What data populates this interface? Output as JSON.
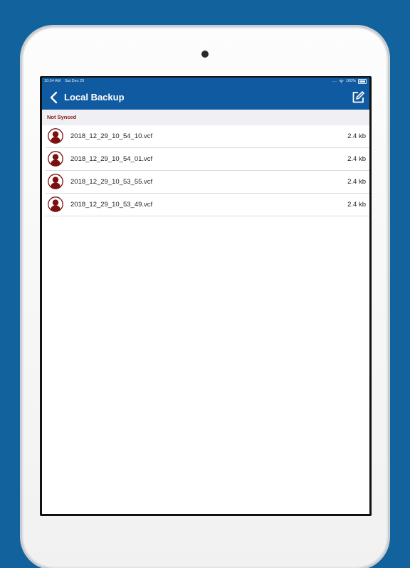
{
  "status_bar": {
    "time": "10:54 AM",
    "date": "Sat Dec 29",
    "signal": "....",
    "battery": "100%"
  },
  "nav": {
    "title": "Local Backup",
    "back_icon": "chevron-left-icon",
    "edit_icon": "compose-icon"
  },
  "section": {
    "title": "Not Synced"
  },
  "files": [
    {
      "name": "2018_12_29_10_54_10.vcf",
      "size": "2.4 kb"
    },
    {
      "name": "2018_12_29_10_54_01.vcf",
      "size": "2.4 kb"
    },
    {
      "name": "2018_12_29_10_53_55.vcf",
      "size": "2.4 kb"
    },
    {
      "name": "2018_12_29_10_53_49.vcf",
      "size": "2.4 kb"
    }
  ],
  "colors": {
    "background": "#12639d",
    "navbar": "#0f5aa0",
    "section_text": "#8b1a1a",
    "avatar": "#7a1010"
  }
}
